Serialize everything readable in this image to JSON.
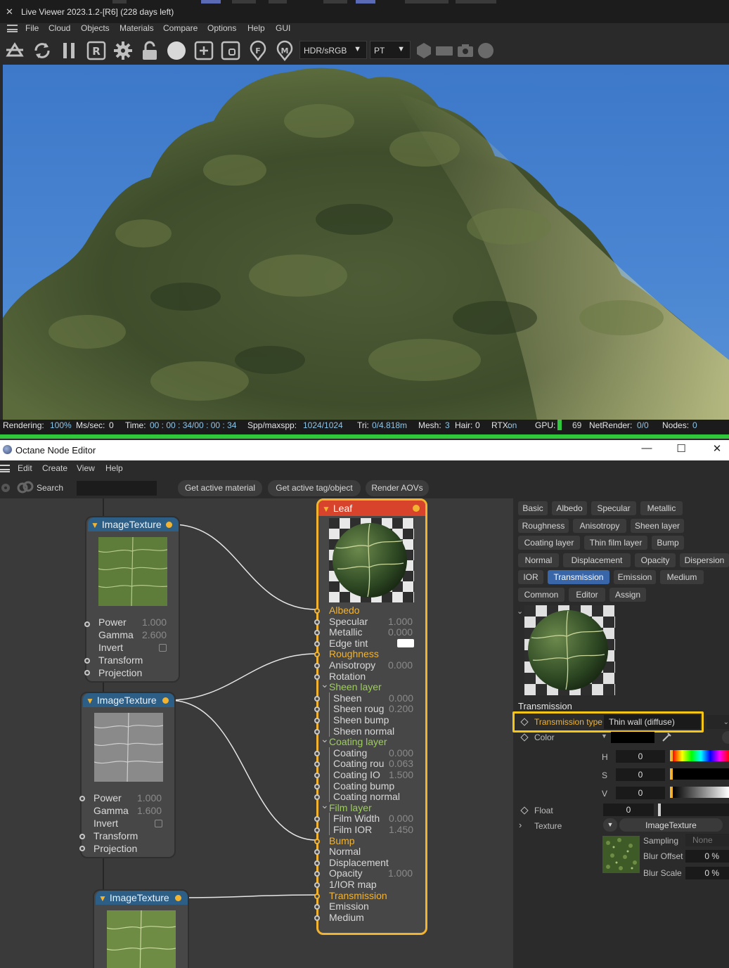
{
  "live_viewer": {
    "title": "Live Viewer 2023.1.2-[R6] (228 days left)",
    "close": "✕",
    "menu": [
      "File",
      "Cloud",
      "Objects",
      "Materials",
      "Compare",
      "Options",
      "Help",
      "GUI"
    ],
    "toolbar": {
      "color_space": "HDR/sRGB",
      "kernel": "PT"
    },
    "status": {
      "rendering_label": "Rendering:",
      "rendering_value": "100%",
      "mssec_label": "Ms/sec:",
      "mssec_value": "0",
      "time_label": "Time:",
      "time_value": "00 : 00 : 34/00 : 00 : 34",
      "spp_label": "Spp/maxspp:",
      "spp_value": "1024/1024",
      "tri_label": "Tri:",
      "tri_value": "0/4.818m",
      "mesh_label": "Mesh:",
      "mesh_value": "3",
      "hair_label": "Hair:",
      "hair_value": "0",
      "rtx_label": "RTX:",
      "rtx_value": "on",
      "gpu_label": "GPU:",
      "gpu_value": "69",
      "net_label": "NetRender:",
      "net_value": "0/0",
      "nodes_label": "Nodes:",
      "nodes_value": "0"
    },
    "progress": 1.0
  },
  "node_editor": {
    "title": "Octane Node Editor",
    "window_buttons": {
      "minimize": "—",
      "maximize": "☐",
      "close": "✕"
    },
    "menu": [
      "Edit",
      "Create",
      "View",
      "Help"
    ],
    "toolbar": {
      "search_label": "Search",
      "buttons": [
        "Get active material",
        "Get active tag/object",
        "Render AOVs"
      ]
    },
    "texture_nodes": [
      {
        "title": "ImageTexture",
        "rows": [
          {
            "name": "Power",
            "value": "1.000"
          },
          {
            "name": "Gamma",
            "value": "2.600"
          },
          {
            "name": "Invert",
            "value": ""
          },
          {
            "name": "Transform",
            "value": ""
          },
          {
            "name": "Projection",
            "value": ""
          }
        ]
      },
      {
        "title": "ImageTexture",
        "rows": [
          {
            "name": "Power",
            "value": "1.000"
          },
          {
            "name": "Gamma",
            "value": "1.600"
          },
          {
            "name": "Invert",
            "value": ""
          },
          {
            "name": "Transform",
            "value": ""
          },
          {
            "name": "Projection",
            "value": ""
          }
        ]
      },
      {
        "title": "ImageTexture",
        "rows": []
      }
    ],
    "material_node": {
      "title": "Leaf",
      "rows": [
        {
          "name": "Albedo",
          "value": "",
          "state": "on",
          "indent": 0
        },
        {
          "name": "Specular",
          "value": "1.000",
          "state": "off",
          "indent": 0
        },
        {
          "name": "Metallic",
          "value": "0.000",
          "state": "off",
          "indent": 0
        },
        {
          "name": "Edge tint",
          "value": "",
          "state": "off",
          "indent": 0,
          "swatch": "#ffffff"
        },
        {
          "name": "Roughness",
          "value": "",
          "state": "on",
          "indent": 0
        },
        {
          "name": "Anisotropy",
          "value": "0.000",
          "state": "off",
          "indent": 0
        },
        {
          "name": "Rotation",
          "value": "",
          "state": "off",
          "indent": 0
        },
        {
          "name": "Sheen layer",
          "value": "",
          "state": "group",
          "indent": 0
        },
        {
          "name": "Sheen",
          "value": "0.000",
          "state": "off",
          "indent": 1
        },
        {
          "name": "Sheen roug",
          "value": "0.200",
          "state": "off",
          "indent": 1
        },
        {
          "name": "Sheen bump",
          "value": "",
          "state": "off",
          "indent": 1
        },
        {
          "name": "Sheen normal",
          "value": "",
          "state": "off",
          "indent": 1
        },
        {
          "name": "Coating layer",
          "value": "",
          "state": "group",
          "indent": 0
        },
        {
          "name": "Coating",
          "value": "0.000",
          "state": "off",
          "indent": 1
        },
        {
          "name": "Coating rou",
          "value": "0.063",
          "state": "off",
          "indent": 1
        },
        {
          "name": "Coating IO",
          "value": "1.500",
          "state": "off",
          "indent": 1
        },
        {
          "name": "Coating bump",
          "value": "",
          "state": "off",
          "indent": 1
        },
        {
          "name": "Coating normal",
          "value": "",
          "state": "off",
          "indent": 1
        },
        {
          "name": "Film layer",
          "value": "",
          "state": "group",
          "indent": 0
        },
        {
          "name": "Film Width",
          "value": "0.000",
          "state": "off",
          "indent": 1
        },
        {
          "name": "Film IOR",
          "value": "1.450",
          "state": "off",
          "indent": 1
        },
        {
          "name": "Bump",
          "value": "",
          "state": "on",
          "indent": 0
        },
        {
          "name": "Normal",
          "value": "",
          "state": "off",
          "indent": 0
        },
        {
          "name": "Displacement",
          "value": "",
          "state": "off",
          "indent": 0
        },
        {
          "name": "Opacity",
          "value": "1.000",
          "state": "off",
          "indent": 0
        },
        {
          "name": "1/IOR map",
          "value": "",
          "state": "off",
          "indent": 0
        },
        {
          "name": "Transmission",
          "value": "",
          "state": "on",
          "indent": 0
        },
        {
          "name": "Emission",
          "value": "",
          "state": "off",
          "indent": 0
        },
        {
          "name": "Medium",
          "value": "",
          "state": "off",
          "indent": 0
        }
      ]
    },
    "panel": {
      "tabs": [
        [
          "Basic",
          "Albedo",
          "Specular",
          "Metallic"
        ],
        [
          "Roughness",
          "Anisotropy",
          "Sheen layer"
        ],
        [
          "Coating layer",
          "Thin film layer",
          "Bump"
        ],
        [
          "Normal",
          "Displacement",
          "Opacity",
          "Dispersion"
        ],
        [
          "IOR",
          "Transmission",
          "Emission",
          "Medium"
        ],
        [
          "Common",
          "Editor",
          "Assign"
        ]
      ],
      "active_tab": "Transmission",
      "section_title": "Transmission",
      "transmission_type_label": "Transmission type",
      "transmission_type_value": "Thin wall (diffuse)",
      "color_label": "Color",
      "h_label": "H",
      "h_value": "0",
      "s_label": "S",
      "s_value": "0",
      "v_label": "V",
      "v_value": "0",
      "float_label": "Float",
      "float_value": "0",
      "texture_label": "Texture",
      "texture_value": "ImageTexture",
      "sampling_label": "Sampling",
      "sampling_value": "None",
      "blur_offset_label": "Blur Offset",
      "blur_offset_value": "0 %",
      "blur_scale_label": "Blur Scale",
      "blur_scale_value": "0 %"
    },
    "colors": {
      "accent": "#f2b331",
      "highlight_box": "#f5c518",
      "active_tab": "#3966a8",
      "material_header": "#d8432c",
      "texture_header": "#2c5e86"
    }
  }
}
